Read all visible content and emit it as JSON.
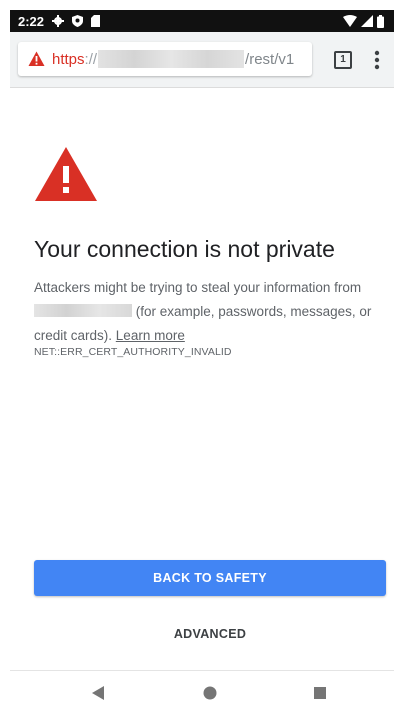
{
  "status_bar": {
    "time": "2:22",
    "left_icons": [
      "settings-gear-icon",
      "shield-icon",
      "sd-card-icon"
    ],
    "right_icons": [
      "wifi-icon",
      "cell-signal-icon",
      "battery-icon"
    ]
  },
  "toolbar": {
    "url_scheme": "https",
    "url_separator": "://",
    "url_path": "/rest/v1",
    "tab_count": "1",
    "warning_color": "#d93025"
  },
  "interstitial": {
    "heading": "Your connection is not private",
    "body_line1": "Attackers might be trying to steal your information from",
    "body_line2": "(for example, passwords, messages, or",
    "body_line3": "credit cards).",
    "learn_more": "Learn more",
    "error_code": "NET::ERR_CERT_AUTHORITY_INVALID",
    "triangle_color": "#d93025"
  },
  "buttons": {
    "back_to_safety": "BACK TO SAFETY",
    "advanced": "ADVANCED",
    "primary_color": "#4285f4"
  },
  "nav_bar": {
    "icons": [
      "back-triangle-icon",
      "home-circle-icon",
      "recents-square-icon"
    ]
  }
}
